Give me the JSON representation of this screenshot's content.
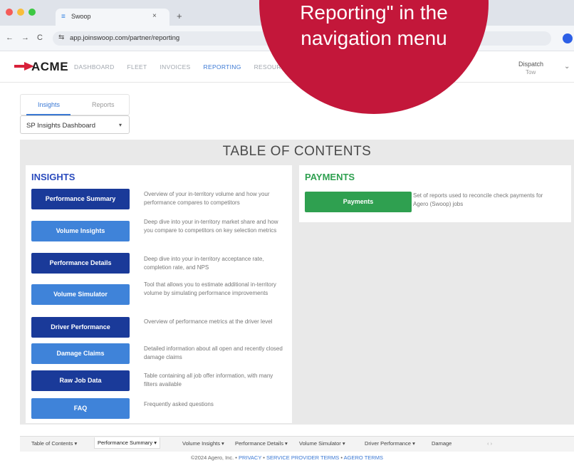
{
  "browser": {
    "tab_title": "Swoop",
    "tab_close": "×",
    "new_tab": "+",
    "url": "app.joinswoop.com/partner/reporting",
    "back": "←",
    "forward": "→",
    "reload": "C",
    "dot_colors": [
      "#f45b58",
      "#f8bd3b",
      "#3cc843"
    ]
  },
  "header": {
    "logo": "ACME",
    "nav": [
      "DASHBOARD",
      "FLEET",
      "INVOICES",
      "REPORTING",
      "RESOURC"
    ],
    "active_nav": "REPORTING",
    "user": "Dispatch",
    "user_sub": "Tow",
    "accent": "#3a78d4"
  },
  "page": {
    "tabs": [
      "Insights",
      "Reports"
    ],
    "active_tab": "Insights",
    "dashboard_select": "SP Insights Dashboard",
    "toc_title": "TABLE OF CONTENTS"
  },
  "insights": {
    "heading": "INSIGHTS",
    "heading_color": "#2a4bbd",
    "items": [
      {
        "label": "Performance Summary",
        "style": "dark",
        "desc": "Overview of your in-territory volume and how your performance compares to competitors"
      },
      {
        "label": "Volume Insights",
        "style": "light",
        "desc": "Deep dive into your in-territory market share and how you compare to competitors on key selection metrics"
      },
      {
        "label": "Performance Details",
        "style": "dark",
        "desc": "Deep dive into your in-territory acceptance rate, completion rate, and NPS"
      },
      {
        "label": "Volume Simulator",
        "style": "light",
        "desc": "Tool that allows you to estimate additional in-territory volume by simulating performance improvements"
      },
      {
        "label": "Driver Performance",
        "style": "dark",
        "desc": "Overview of performance metrics at the driver level"
      },
      {
        "label": "Damage Claims",
        "style": "light",
        "desc": "Detailed information about all open and recently closed damage claims"
      },
      {
        "label": "Raw Job Data",
        "style": "dark",
        "desc": "Table containing all job offer information, with many filters available"
      },
      {
        "label": "FAQ",
        "style": "light",
        "desc": "Frequently asked questions"
      }
    ]
  },
  "payments": {
    "heading": "PAYMENTS",
    "heading_color": "#2fa050",
    "button": "Payments",
    "desc": "Set of reports used to reconcile check payments for Agero (Swoop) jobs"
  },
  "sheets": [
    "Table of Contents ▾",
    "Performance Summary ▾",
    "Volume Insights ▾",
    "Performance Details ▾",
    "Volume Simulator ▾",
    "Driver Performance ▾",
    "Damage"
  ],
  "active_sheet": "Performance Summary ▾",
  "sheet_scroll": "‹ ›",
  "footer": {
    "copyright": "©2024 Agero, Inc.",
    "sep": " • ",
    "links": [
      "PRIVACY",
      "SERVICE PROVIDER TERMS",
      "AGERO TERMS"
    ]
  },
  "callout": {
    "line1": "Reporting\" in the",
    "line2": "navigation menu",
    "color": "#c3173a"
  }
}
